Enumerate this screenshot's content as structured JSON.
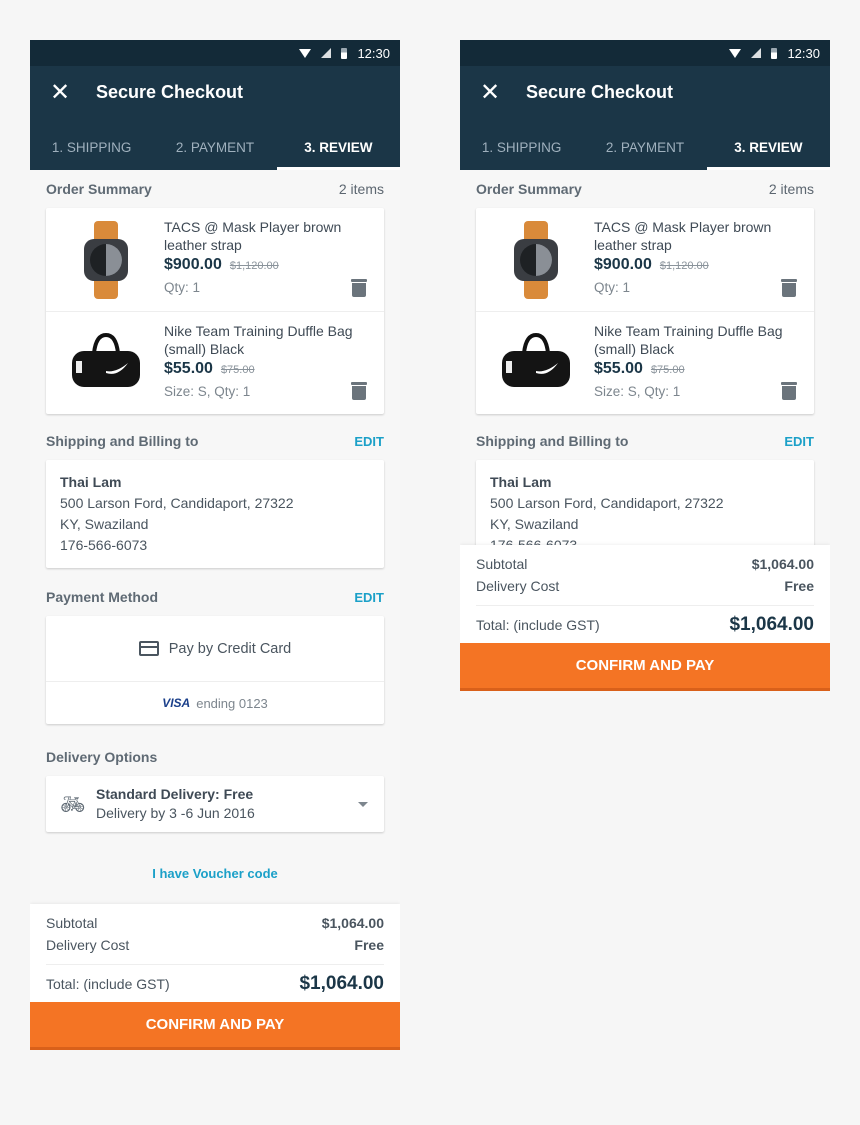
{
  "status_bar": {
    "time": "12:30"
  },
  "app_bar": {
    "title": "Secure Checkout",
    "close_icon": "close-icon"
  },
  "tabs": [
    {
      "label": "1. SHIPPING",
      "active": false
    },
    {
      "label": "2. PAYMENT",
      "active": false
    },
    {
      "label": "3. REVIEW",
      "active": true
    }
  ],
  "order_summary": {
    "heading": "Order Summary",
    "count": "2 items",
    "items": [
      {
        "name": "TACS @ Mask Player brown leather strap",
        "price": "$900.00",
        "old_price": "$1,120.00",
        "meta": "Qty: 1",
        "image": "watch"
      },
      {
        "name": "Nike Team Training Duffle Bag (small) Black",
        "price": "$55.00",
        "old_price": "$75.00",
        "meta": "Size: S, Qty: 1",
        "image": "duffle-bag"
      }
    ]
  },
  "shipping": {
    "heading": "Shipping and Billing to",
    "edit_label": "EDIT",
    "name": "Thai Lam",
    "line1": "500 Larson Ford,  Candidaport,  27322",
    "line2": "KY, Swaziland",
    "phone": "176-566-6073"
  },
  "payment": {
    "heading": "Payment Method",
    "edit_label": "EDIT",
    "method": "Pay by Credit Card",
    "card_brand": "VISA",
    "card_ending": "ending 0123"
  },
  "delivery": {
    "heading": "Delivery Options",
    "option": "Standard Delivery:  Free",
    "estimate": "Delivery by 3 -6 Jun 2016"
  },
  "voucher_link": "I have Voucher code",
  "totals": {
    "subtotal_label": "Subtotal",
    "subtotal": "$1,064.00",
    "delivery_label": "Delivery Cost",
    "delivery": "Free",
    "total_label": "Total: (include GST)",
    "total": "$1,064.00"
  },
  "confirm_label": "CONFIRM AND PAY",
  "colors": {
    "header": "#1b3647",
    "status_bar": "#132a38",
    "accent": "#f47424",
    "link": "#1ba0c8"
  }
}
